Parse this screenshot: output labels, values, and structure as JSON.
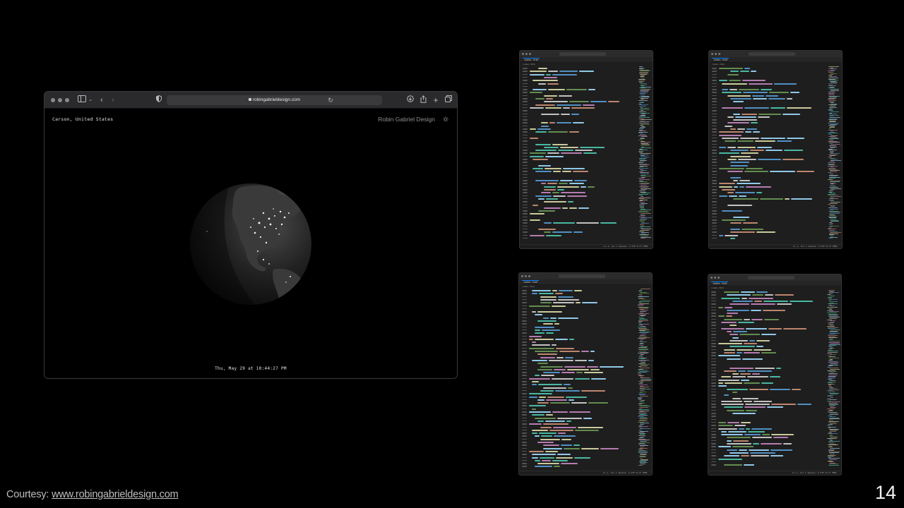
{
  "browser": {
    "url": "robingabrieldesign.com"
  },
  "site": {
    "location": "Carson, United States",
    "brand": "Robin Gabriel Design",
    "datetime": "Thu, May 29 at 10:44:27 PM"
  },
  "icons": {
    "sidebar": "sidebar-icon",
    "back": "chevron-left-icon",
    "forward": "chevron-right-icon",
    "shield": "shield-icon",
    "reload": "reload-icon",
    "download": "download-icon",
    "share": "share-icon",
    "new_tab": "plus-icon",
    "tabs": "tabs-overview-icon",
    "theme": "sun-icon"
  },
  "editors": [
    {
      "tab": "index.html",
      "status": "Ln 1, Col 1   Spaces: 2   UTF-8   LF   HTML"
    },
    {
      "tab": "index.html",
      "status": "Ln 1, Col 1   Spaces: 2   UTF-8   LF   HTML"
    },
    {
      "tab": "index.html",
      "status": "Ln 1, Col 1   Spaces: 2   UTF-8   LF   HTML"
    },
    {
      "tab": "index.html",
      "status": "Ln 1, Col 1   Spaces: 2   UTF-8   LF   HTML"
    }
  ],
  "footer": {
    "courtesy_label": "Courtesy: ",
    "courtesy_link": "www.robingabrieldesign.com",
    "page_number": "14"
  }
}
